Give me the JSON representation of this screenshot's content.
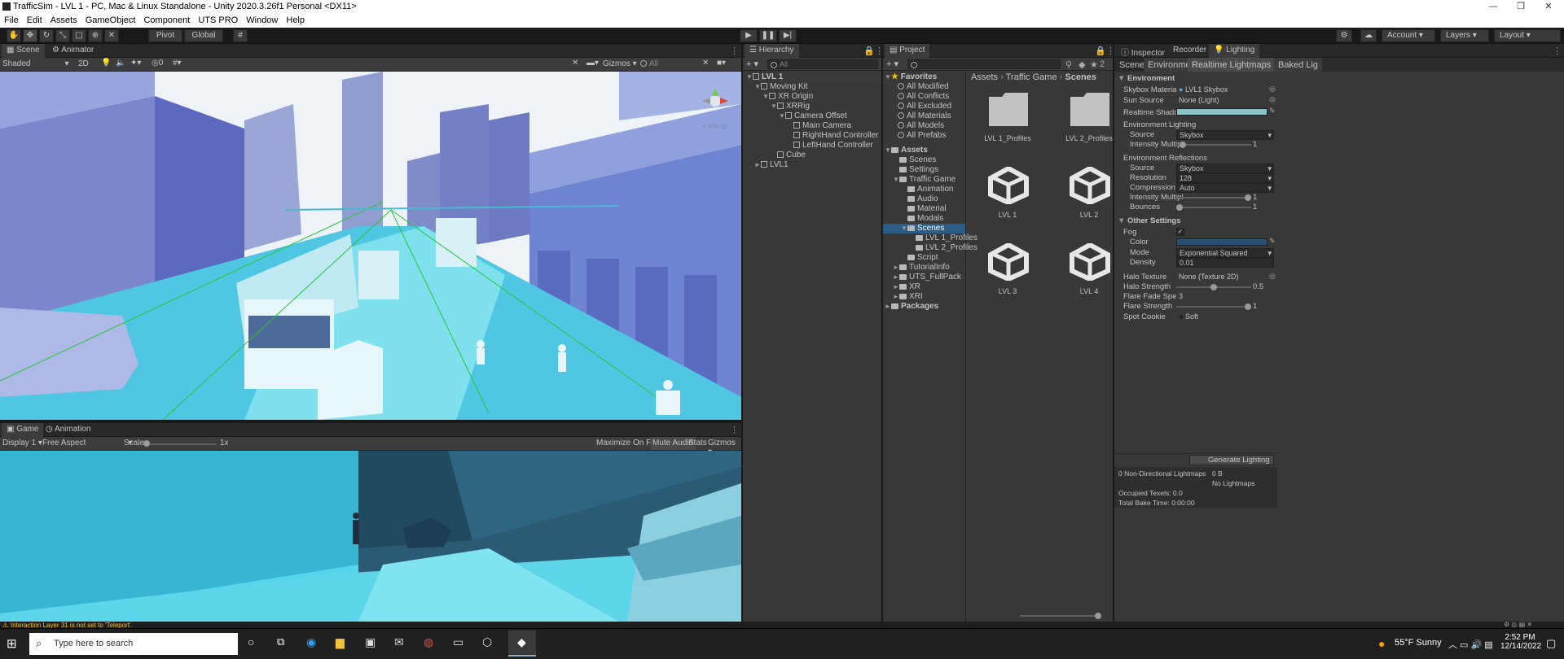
{
  "window": {
    "title": "TrafficSim - LVL 1 - PC, Mac & Linux Standalone - Unity 2020.3.26f1 Personal <DX11>"
  },
  "menu": [
    "File",
    "Edit",
    "Assets",
    "GameObject",
    "Component",
    "UTS PRO",
    "Window",
    "Help"
  ],
  "toolbar": {
    "pivot": "Pivot",
    "global": "Global",
    "account": "Account",
    "layers": "Layers",
    "layout": "Layout"
  },
  "scene": {
    "tab_scene": "Scene",
    "tab_animator": "Animator",
    "shading": "Shaded",
    "mode2d": "2D",
    "gizmos": "Gizmos",
    "search_placeholder": "All",
    "persp": "< Persp"
  },
  "game": {
    "tab_game": "Game",
    "tab_animation": "Animation",
    "display": "Display 1",
    "aspect": "Free Aspect",
    "scale_label": "Scale",
    "scale_value": "1x",
    "maximize": "Maximize On Play",
    "mute": "Mute Audio",
    "stats": "Stats",
    "gizmos": "Gizmos"
  },
  "hierarchy": {
    "title": "Hierarchy",
    "search_placeholder": "All",
    "items": [
      {
        "label": "LVL 1",
        "depth": 0,
        "kind": "scene",
        "arrow": "▼"
      },
      {
        "label": "Moving Kit",
        "depth": 1,
        "kind": "obj",
        "arrow": "▼"
      },
      {
        "label": "XR Origin",
        "depth": 2,
        "kind": "obj",
        "arrow": "▼"
      },
      {
        "label": "XRRig",
        "depth": 3,
        "kind": "obj",
        "arrow": "▼"
      },
      {
        "label": "Camera Offset",
        "depth": 4,
        "kind": "obj",
        "arrow": "▼"
      },
      {
        "label": "Main Camera",
        "depth": 5,
        "kind": "obj",
        "arrow": ""
      },
      {
        "label": "RightHand Controller",
        "depth": 5,
        "kind": "obj",
        "arrow": ""
      },
      {
        "label": "LeftHand Controller",
        "depth": 5,
        "kind": "obj",
        "arrow": ""
      },
      {
        "label": "Cube",
        "depth": 3,
        "kind": "obj",
        "arrow": ""
      },
      {
        "label": "LVL1",
        "depth": 1,
        "kind": "obj",
        "arrow": "►"
      }
    ]
  },
  "project": {
    "title": "Project",
    "breadcrumb": [
      "Assets",
      "Traffic Game",
      "Scenes"
    ],
    "favorites_label": "Favorites",
    "favorites": [
      "All Modified",
      "All Conflicts",
      "All Excluded",
      "All Materials",
      "All Models",
      "All Prefabs"
    ],
    "tree": [
      {
        "label": "Assets",
        "depth": 0,
        "arrow": "▼",
        "bold": true
      },
      {
        "label": "Scenes",
        "depth": 1,
        "arrow": ""
      },
      {
        "label": "Settings",
        "depth": 1,
        "arrow": ""
      },
      {
        "label": "Traffic Game",
        "depth": 1,
        "arrow": "▼"
      },
      {
        "label": "Animation",
        "depth": 2,
        "arrow": ""
      },
      {
        "label": "Audio",
        "depth": 2,
        "arrow": ""
      },
      {
        "label": "Material",
        "depth": 2,
        "arrow": ""
      },
      {
        "label": "Modals",
        "depth": 2,
        "arrow": ""
      },
      {
        "label": "Scenes",
        "depth": 2,
        "arrow": "▼",
        "selected": true
      },
      {
        "label": "LVL 1_Profiles",
        "depth": 3,
        "arrow": ""
      },
      {
        "label": "LVL 2_Profiles",
        "depth": 3,
        "arrow": ""
      },
      {
        "label": "Script",
        "depth": 2,
        "arrow": ""
      },
      {
        "label": "TutorialInfo",
        "depth": 1,
        "arrow": "►"
      },
      {
        "label": "UTS_FullPack",
        "depth": 1,
        "arrow": "►"
      },
      {
        "label": "XR",
        "depth": 1,
        "arrow": "►"
      },
      {
        "label": "XRI",
        "depth": 1,
        "arrow": "►"
      },
      {
        "label": "Packages",
        "depth": 0,
        "arrow": "►",
        "bold": true
      }
    ],
    "assets": [
      {
        "label": "LVL 1_Profiles",
        "kind": "folder"
      },
      {
        "label": "LVL 2_Profiles",
        "kind": "folder"
      },
      {
        "label": "LVL 1",
        "kind": "unity"
      },
      {
        "label": "LVL 2",
        "kind": "unity"
      },
      {
        "label": "LVL 3",
        "kind": "unity"
      },
      {
        "label": "LVL 4",
        "kind": "unity"
      }
    ],
    "badge": "2"
  },
  "inspector": {
    "tabs": [
      "Inspector",
      "Recorder",
      "Lighting"
    ],
    "subtabs": [
      "Scene",
      "Environment",
      "Realtime Lightmaps",
      "Baked Lig"
    ],
    "environment_header": "Environment",
    "skybox_label": "Skybox Material",
    "skybox_value": "LVL1 Skybox",
    "sun_label": "Sun Source",
    "sun_value": "None (Light)",
    "realtime_shadow_label": "Realtime Shadow C",
    "env_lighting_header": "Environment Lighting",
    "source_label": "Source",
    "source_value": "Skybox",
    "intensity_label": "Intensity Multipl",
    "intensity_value": "1",
    "intensity_level": 0.05,
    "env_refl_header": "Environment Reflections",
    "refl_source_value": "Skybox",
    "resolution_label": "Resolution",
    "resolution_value": "128",
    "compression_label": "Compression",
    "compression_value": "Auto",
    "refl_intensity_value": "1",
    "refl_intensity_level": 1.0,
    "bounces_label": "Bounces",
    "bounces_value": "1",
    "bounces_level": 0.0,
    "other_header": "Other Settings",
    "fog_label": "Fog",
    "fog_check": "✓",
    "color_label": "Color",
    "mode_label": "Mode",
    "mode_value": "Exponential Squared",
    "density_label": "Density",
    "density_value": "0.01",
    "halo_tex_label": "Halo Texture",
    "halo_tex_value": "None (Texture 2D)",
    "halo_strength_label": "Halo Strength",
    "halo_strength_value": "0.5",
    "halo_strength_level": 0.5,
    "flare_fade_label": "Flare Fade Speed",
    "flare_fade_value": "3",
    "flare_strength_label": "Flare Strength",
    "flare_strength_value": "1",
    "flare_strength_level": 1.0,
    "spot_label": "Spot Cookie",
    "spot_value": "Soft",
    "generate_button": "Generate Lighting",
    "lm_label": "0 Non-Directional Lightmaps",
    "lm_size": "0 B",
    "no_lightmaps": "No Lightmaps",
    "texels": "Occupied Texels: 0.0",
    "bake_time": "Total Bake Time: 0:00:00"
  },
  "status": {
    "warning": "Interaction Layer 31 is not set to 'Teleport'."
  },
  "taskbar": {
    "search_placeholder": "Type here to search",
    "weather": "55°F  Sunny",
    "time": "2:52 PM",
    "date": "12/14/2022"
  },
  "colors": {
    "accent_selected": "#2c5d87",
    "sky": "#e8f0f8",
    "warning": "#f0c040"
  }
}
